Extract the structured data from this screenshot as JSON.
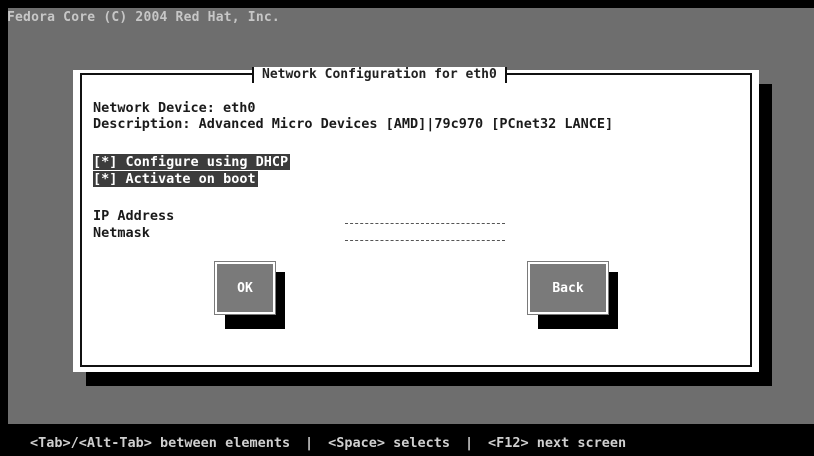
{
  "header": {
    "text": "Fedora Core (C) 2004 Red Hat, Inc."
  },
  "dialog": {
    "title": "Network Configuration for eth0",
    "device_line": "Network Device: eth0",
    "description_line": "Description: Advanced Micro Devices [AMD]|79c970 [PCnet32 LANCE]",
    "checkboxes": [
      {
        "mark": "[*]",
        "label": "Configure using DHCP",
        "checked": true
      },
      {
        "mark": "[*]",
        "label": "Activate on boot",
        "checked": true
      }
    ],
    "fields": [
      {
        "label": "IP Address",
        "value": ""
      },
      {
        "label": "Netmask",
        "value": ""
      }
    ],
    "buttons": {
      "ok_label": "OK",
      "back_label": "Back"
    }
  },
  "footer": {
    "hint_tab": "<Tab>/<Alt-Tab> between elements",
    "separator": "|",
    "hint_space": "<Space> selects",
    "hint_f12": "<F12> next screen"
  },
  "colors": {
    "background": "#6e6e6e",
    "dialog": "#ffffff",
    "highlight": "#3c3c3c",
    "button": "#7a7a7a"
  }
}
